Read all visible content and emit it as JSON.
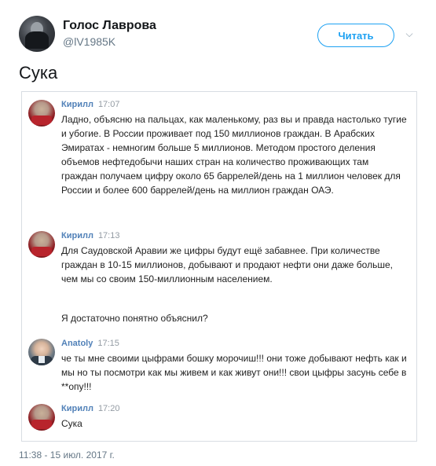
{
  "header": {
    "display_name": "Голос Лаврова",
    "handle": "@lV1985K",
    "follow_label": "Читать",
    "caret": "⌵"
  },
  "tweet": {
    "text": "Сука",
    "timestamp": "11:38 - 15 июл. 2017 г."
  },
  "chat": {
    "messages": [
      {
        "author": "Кирилл",
        "time": "17:07",
        "text": "Ладно, объясню на пальцах, как маленькому, раз вы и правда настолько тугие и убогие. В России проживает под 150 миллионов граждан. В Арабских Эмиратах - немногим больше 5 миллионов. Методом простого деления объемов нефтедобычи наших стран на количество проживающих там граждан получаем цифру около 65 баррелей/день на 1 миллион человек для России и более 600 баррелей/день на миллион граждан ОАЭ."
      },
      {
        "author": "Кирилл",
        "time": "17:13",
        "text": "Для Саудовской Аравии же цифры будут ещё забавнее. При количестве граждан в 10-15 миллионов, добывают и продают нефти они даже больше, чем мы со своим 150-миллионным населением.",
        "text2": "Я достаточно понятно объяснил?"
      },
      {
        "author": "Anatoly",
        "time": "17:15",
        "text": "че ты мне своими цыфрами бошку морочиш!!! они тоже добывают нефть как и мы но ты посмотри как мы живем и как живут они!!! свои цыфры засунь себе в **опу!!!"
      },
      {
        "author": "Кирилл",
        "time": "17:20",
        "text": "Сука"
      }
    ]
  }
}
